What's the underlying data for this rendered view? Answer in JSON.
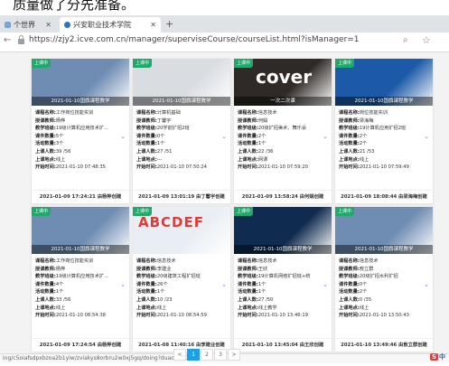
{
  "cropped_heading": "质量做了分先准备。",
  "browser": {
    "tabs": [
      {
        "title": "个世界"
      },
      {
        "title": "兴安职业技术学院"
      }
    ],
    "new_tab": "+",
    "url": "https://zjy2.icve.com.cn/manager/superviseCourse/courseList.html?isManager=1",
    "status_url": "ing/c5oiafsdpxbzoa2b1yiw/zviakys8orbru2w0xj5gq/doing?duadao=1"
  },
  "labels": {
    "name": "课程名称:",
    "teacher": "授课教师:",
    "class": "教学班级:",
    "lessons": "课件数量:",
    "activities": "活动数量:",
    "students": "上课人数:",
    "mode": "上课地点:",
    "start": "开始时间:"
  },
  "cards": [
    {
      "ribbon": "上课中",
      "cover_title": "2021-01-10国旗课程教学",
      "name": "工作岗位技能实训",
      "teacher": "杨桦",
      "class": "19级计算机应用技术扩...",
      "lessons": "5个",
      "activities": "3个",
      "students": "39 /56",
      "mode": "线上",
      "start": "2021-01-10 07:48:35",
      "footer": "2021-01-09 17:24:21 由杨桦创建",
      "cover": "#6f8db3",
      "cover_text": "",
      "cover_color": "#fff"
    },
    {
      "ribbon": "上课中",
      "cover_title": "2021-01-10国旗课程教学",
      "name": "计算机基础",
      "teacher": "丁馨宇",
      "class": "20学前扩招2班",
      "lessons": "0个",
      "activities": "1个",
      "students": "27 /51",
      "mode": "---",
      "start": "2021-01-10 07:50:24",
      "footer": "2021-01-09 13:01:19 由丁馨宇创建",
      "cover": "#d9dde2",
      "cover_text": "",
      "cover_color": "#333"
    },
    {
      "ribbon": "上课中",
      "cover_title": "一次二次课",
      "name": "信息技术",
      "teacher": "何娟",
      "class": "20级扩招美术、舞乐会",
      "lessons": "2个",
      "activities": "1个",
      "students": "22 /36",
      "mode": "网课",
      "start": "2021-01-10 07:59:20",
      "footer": "2021-01-09 13:58:24 由何娟创建",
      "cover": "#2f2a26",
      "cover_text": "cover",
      "cover_color": "#ffffff"
    },
    {
      "ribbon": "上课中",
      "cover_title": "2021-01-10国旗课程教学",
      "name": "岗位技能实训",
      "teacher": "梁海梅",
      "class": "19计算机应用扩招2班",
      "lessons": "2个",
      "activities": "2个",
      "students": "21 /53",
      "mode": "线上",
      "start": "2021-01-10 07:59:49",
      "footer": "2021-01-09 18:08:44 由梁海梅创建",
      "cover": "#1c5aa8",
      "cover_text": "",
      "cover_color": "#fff"
    },
    {
      "ribbon": "上课中",
      "cover_title": "2021-01-10国旗课程教学",
      "name": "工作岗位技能实训",
      "teacher": "杨桦",
      "class": "19级计算机应用技术扩...",
      "lessons": "4个",
      "activities": "1个",
      "students": "33 /56",
      "mode": "线上",
      "start": "2021-01-10 08:54:38",
      "footer": "2021-01-09 17:24:54 由杨桦创建",
      "cover": "#6f8db3",
      "cover_text": "",
      "cover_color": "#fff"
    },
    {
      "ribbon": "上课中",
      "cover_title": "",
      "name": "信息技术",
      "teacher": "李建业",
      "class": "20级建筑工程扩招班",
      "lessons": "26个",
      "activities": "1个",
      "students": "10 /23",
      "mode": "线上",
      "start": "2021-01-10 08:54:59",
      "footer": "2021-01-08 11:40:16 由李建业创建",
      "cover": "#e9eef4",
      "cover_text": "ABCDEF",
      "cover_color": "#e53935"
    },
    {
      "ribbon": "上课中",
      "cover_title": "2021-01-10国旗课程教学",
      "name": "信息技术",
      "teacher": "王欣",
      "class": "19计算机网络扩招班+统",
      "lessons": "1个",
      "activities": "1个",
      "students": "27 /50",
      "mode": "线上教学",
      "start": "2021-01-10 13:46:19",
      "footer": "2021-01-10 13:45:04 由王欣创建",
      "cover": "#0f2b50",
      "cover_text": "",
      "cover_color": "#fff"
    },
    {
      "ribbon": "上课中",
      "cover_title": "2021-01-10国旗课程教学",
      "name": "信息技术",
      "teacher": "敖立群",
      "class": "20级扩招水利扩招",
      "lessons": "0个",
      "activities": "2个",
      "students": "0 /35",
      "mode": "线上",
      "start": "2021-01-10 13:50:43",
      "footer": "2021-01-10 13:49:46 由敖立群创建",
      "cover": "#6f8db3",
      "cover_text": "",
      "cover_color": "#fff"
    }
  ],
  "pager": {
    "prev": "<",
    "pages": [
      "1",
      "2",
      "3"
    ],
    "next": ">"
  },
  "tray": {
    "ime": "S",
    "lang": "中"
  }
}
